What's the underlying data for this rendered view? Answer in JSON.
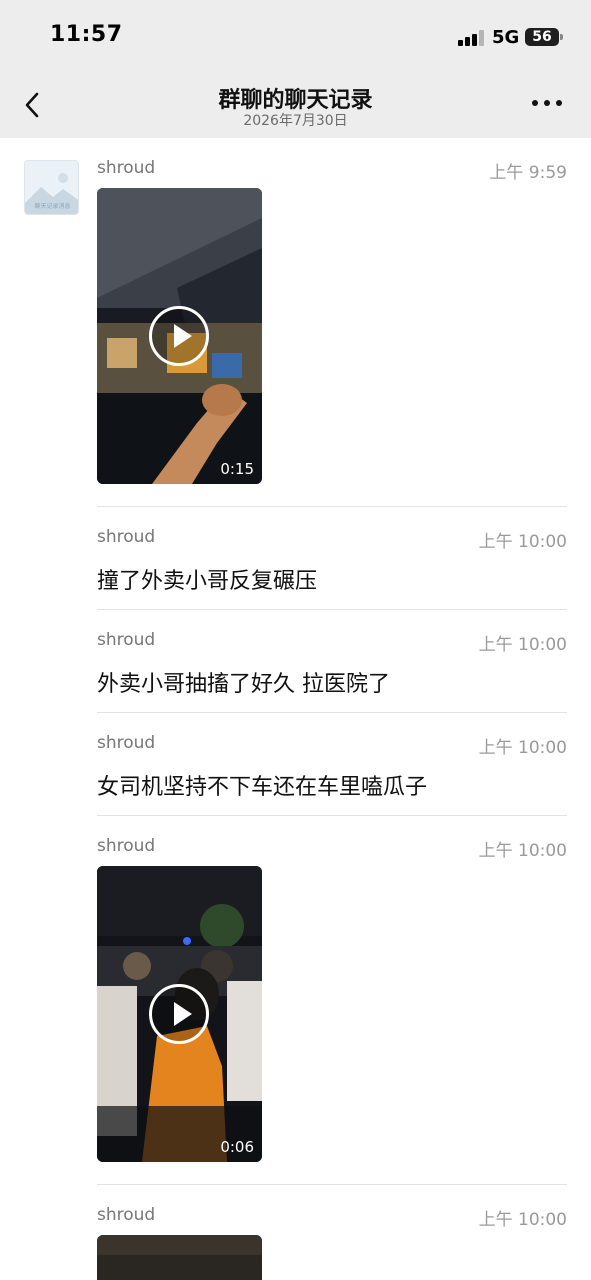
{
  "status": {
    "time": "11:57",
    "network": "5G",
    "battery": "56"
  },
  "nav": {
    "title": "群聊的聊天记录",
    "subtitle": "2026年7月30日",
    "back_icon": "chevron-left-icon",
    "more_icon": "more-dots-icon"
  },
  "avatar": {
    "label": "聊天记录消息"
  },
  "messages": [
    {
      "sender": "shroud",
      "time": "上午 9:59",
      "type": "video",
      "duration": "0:15"
    },
    {
      "sender": "shroud",
      "time": "上午 10:00",
      "type": "text",
      "text": "撞了外卖小哥反复碾压"
    },
    {
      "sender": "shroud",
      "time": "上午 10:00",
      "type": "text",
      "text": "外卖小哥抽搐了好久 拉医院了"
    },
    {
      "sender": "shroud",
      "time": "上午 10:00",
      "type": "text",
      "text": "女司机坚持不下车还在车里嗑瓜子"
    },
    {
      "sender": "shroud",
      "time": "上午 10:00",
      "type": "video",
      "duration": "0:06"
    },
    {
      "sender": "shroud",
      "time": "上午 10:00",
      "type": "video"
    }
  ],
  "colors": {
    "header_bg": "#ededed",
    "meta_text": "#9a9a9a",
    "divider": "#e3e3e3"
  }
}
